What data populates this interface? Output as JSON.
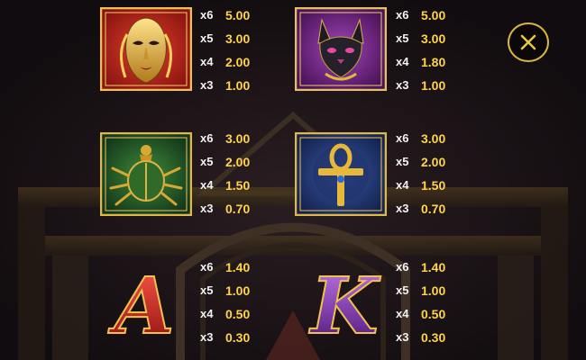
{
  "close_button": {
    "icon": "close-icon",
    "color": "#d9b63a"
  },
  "symbols": [
    {
      "id": "mask",
      "icon": "pharaoh-mask-icon",
      "frame_color": "#c0261c",
      "pays": [
        {
          "count": "x6",
          "value": "5.00"
        },
        {
          "count": "x5",
          "value": "3.00"
        },
        {
          "count": "x4",
          "value": "2.00"
        },
        {
          "count": "x3",
          "value": "1.00"
        }
      ]
    },
    {
      "id": "cat",
      "icon": "bastet-cat-icon",
      "frame_color": "#7a2a8c",
      "pays": [
        {
          "count": "x6",
          "value": "5.00"
        },
        {
          "count": "x5",
          "value": "3.00"
        },
        {
          "count": "x4",
          "value": "1.80"
        },
        {
          "count": "x3",
          "value": "1.00"
        }
      ]
    },
    {
      "id": "scarab",
      "icon": "scarab-icon",
      "frame_color": "#2e7a2a",
      "pays": [
        {
          "count": "x6",
          "value": "3.00"
        },
        {
          "count": "x5",
          "value": "2.00"
        },
        {
          "count": "x4",
          "value": "1.50"
        },
        {
          "count": "x3",
          "value": "0.70"
        }
      ]
    },
    {
      "id": "ankh",
      "icon": "ankh-icon",
      "frame_color": "#2a4a9a",
      "pays": [
        {
          "count": "x6",
          "value": "3.00"
        },
        {
          "count": "x5",
          "value": "2.00"
        },
        {
          "count": "x4",
          "value": "1.50"
        },
        {
          "count": "x3",
          "value": "0.70"
        }
      ]
    },
    {
      "id": "letter-a",
      "icon": "letter-a-icon",
      "letter": "A",
      "frame_color": "#c0261c",
      "pays": [
        {
          "count": "x6",
          "value": "1.40"
        },
        {
          "count": "x5",
          "value": "1.00"
        },
        {
          "count": "x4",
          "value": "0.50"
        },
        {
          "count": "x3",
          "value": "0.30"
        }
      ]
    },
    {
      "id": "letter-k",
      "icon": "letter-k-icon",
      "letter": "K",
      "frame_color": "#7a3aa8",
      "pays": [
        {
          "count": "x6",
          "value": "1.40"
        },
        {
          "count": "x5",
          "value": "1.00"
        },
        {
          "count": "x4",
          "value": "0.50"
        },
        {
          "count": "x3",
          "value": "0.30"
        }
      ]
    }
  ]
}
